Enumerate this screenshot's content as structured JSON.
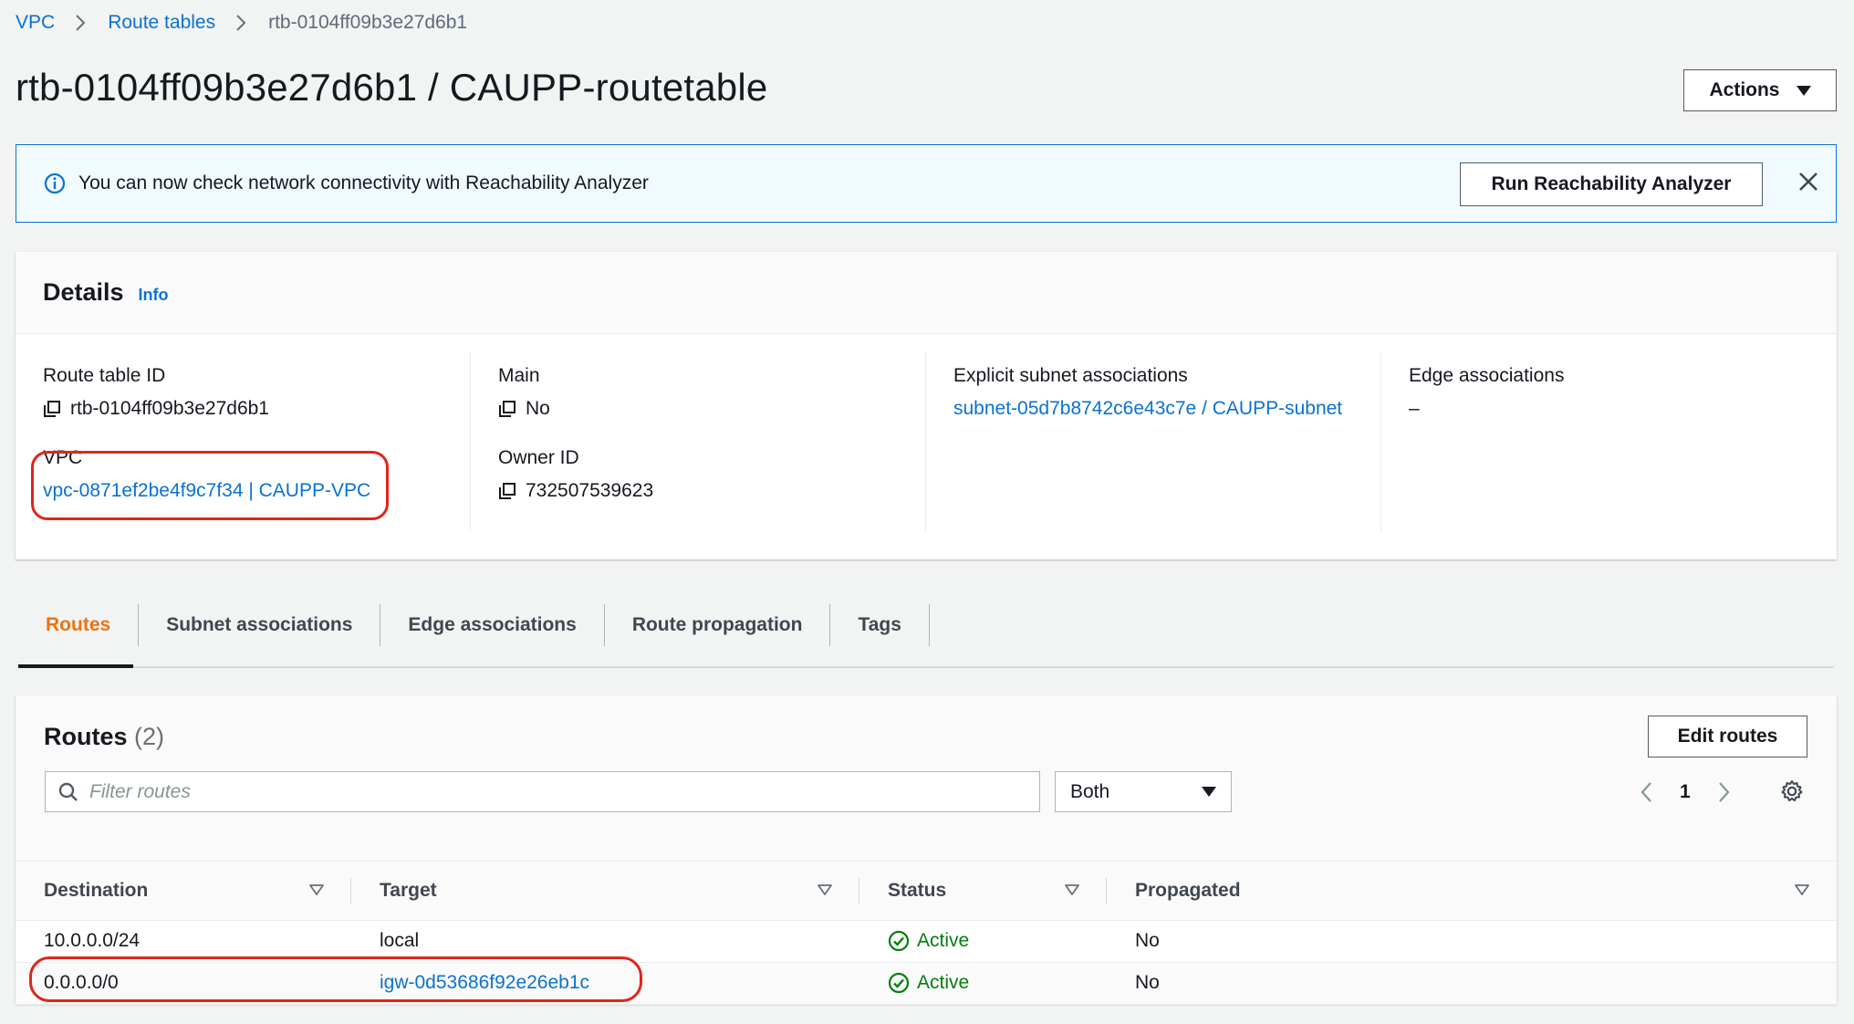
{
  "breadcrumb": {
    "items": [
      "VPC",
      "Route tables"
    ],
    "current": "rtb-0104ff09b3e27d6b1"
  },
  "header": {
    "title": "rtb-0104ff09b3e27d6b1 / CAUPP-routetable",
    "actions_label": "Actions"
  },
  "banner": {
    "message": "You can now check network connectivity with Reachability Analyzer",
    "button_label": "Run Reachability Analyzer"
  },
  "details": {
    "title": "Details",
    "info_label": "Info",
    "route_table_id_label": "Route table ID",
    "route_table_id_value": "rtb-0104ff09b3e27d6b1",
    "vpc_label": "VPC",
    "vpc_value": "vpc-0871ef2be4f9c7f34 | CAUPP-VPC",
    "main_label": "Main",
    "main_value": "No",
    "owner_id_label": "Owner ID",
    "owner_id_value": "732507539623",
    "explicit_subnet_label": "Explicit subnet associations",
    "explicit_subnet_value": "subnet-05d7b8742c6e43c7e / CAUPP-subnet",
    "edge_assoc_label": "Edge associations",
    "edge_assoc_value": "–"
  },
  "tabs": [
    {
      "label": "Routes",
      "active": true
    },
    {
      "label": "Subnet associations",
      "active": false
    },
    {
      "label": "Edge associations",
      "active": false
    },
    {
      "label": "Route propagation",
      "active": false
    },
    {
      "label": "Tags",
      "active": false
    }
  ],
  "routes": {
    "title": "Routes",
    "count": "(2)",
    "edit_label": "Edit routes",
    "filter_placeholder": "Filter routes",
    "filter_select_value": "Both",
    "page_number": "1",
    "columns": [
      "Destination",
      "Target",
      "Status",
      "Propagated"
    ],
    "rows": [
      {
        "destination": "10.0.0.0/24",
        "target": "local",
        "target_is_link": false,
        "status": "Active",
        "propagated": "No"
      },
      {
        "destination": "0.0.0.0/0",
        "target": "igw-0d53686f92e26eb1c",
        "target_is_link": true,
        "status": "Active",
        "propagated": "No"
      }
    ]
  },
  "colors": {
    "link": "#0972d3",
    "active_tab": "#ec7211",
    "status_ok": "#037f0c",
    "highlight": "#e0251b"
  }
}
